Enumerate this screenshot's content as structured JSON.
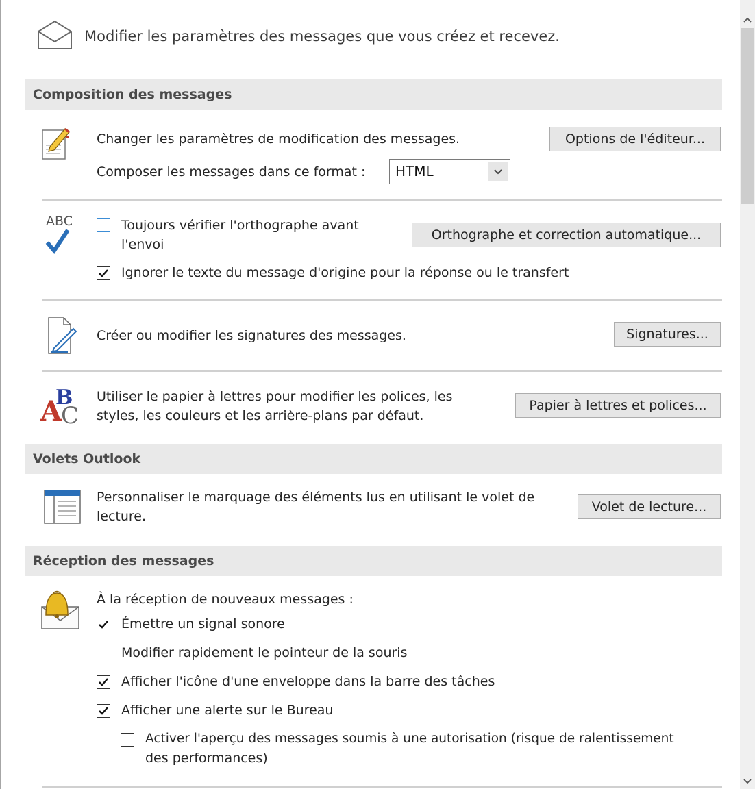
{
  "header": {
    "text": "Modifier les paramètres des messages que vous créez et recevez."
  },
  "sections": {
    "composition": "Composition des messages",
    "volets": "Volets Outlook",
    "reception": "Réception des messages"
  },
  "composition": {
    "editor_desc": "Changer les paramètres de modification des messages.",
    "editor_button": "Options de l'éditeur...",
    "format_label": "Composer les messages dans ce format :",
    "format_value": "HTML",
    "spell_icon_text": "ABC",
    "spell_check_line1": "Toujours vérifier l'orthographe avant",
    "spell_check_line2": "l'envoi",
    "spell_button": "Orthographe et correction automatique...",
    "ignore_text": "Ignorer le texte du message d'origine pour la réponse ou le transfert",
    "signature_desc": "Créer ou modifier les signatures des messages.",
    "signature_button": "Signatures...",
    "stationery_line1": "Utiliser le papier à lettres pour modifier les polices, les",
    "stationery_line2": "styles, les couleurs et les arrière-plans par défaut.",
    "stationery_button": "Papier à lettres et polices..."
  },
  "volets": {
    "reading_line1": "Personnaliser le marquage des éléments lus en utilisant le volet de",
    "reading_line2": "lecture.",
    "reading_button": "Volet de lecture..."
  },
  "reception": {
    "intro": "À la réception de nouveaux messages :",
    "sound": "Émettre un signal sonore",
    "pointer": "Modifier rapidement le pointeur de la souris",
    "envelope": "Afficher l'icône d'une enveloppe dans la barre des tâches",
    "desktop_alert": "Afficher une alerte sur le Bureau",
    "preview_line1": "Activer l'aperçu des messages soumis à une autorisation (risque de ralentissement",
    "preview_line2": "des performances)"
  },
  "checkbox_states": {
    "spell_check": false,
    "ignore_text": true,
    "sound": true,
    "pointer": false,
    "envelope": true,
    "desktop_alert": true,
    "preview": false
  }
}
